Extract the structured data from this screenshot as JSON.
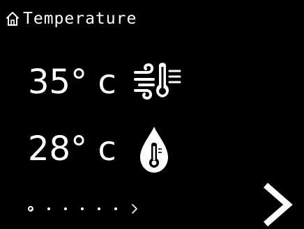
{
  "header": {
    "title": "Temperature",
    "icon": "home-icon"
  },
  "readings": [
    {
      "value": "35° c",
      "icon": "wind-thermometer-icon"
    },
    {
      "value": "28° c",
      "icon": "water-drop-thermometer-icon"
    }
  ],
  "pager": {
    "total_pages": 7,
    "current_page": 1
  },
  "colors": {
    "background": "#000000",
    "foreground": "#ffffff"
  }
}
